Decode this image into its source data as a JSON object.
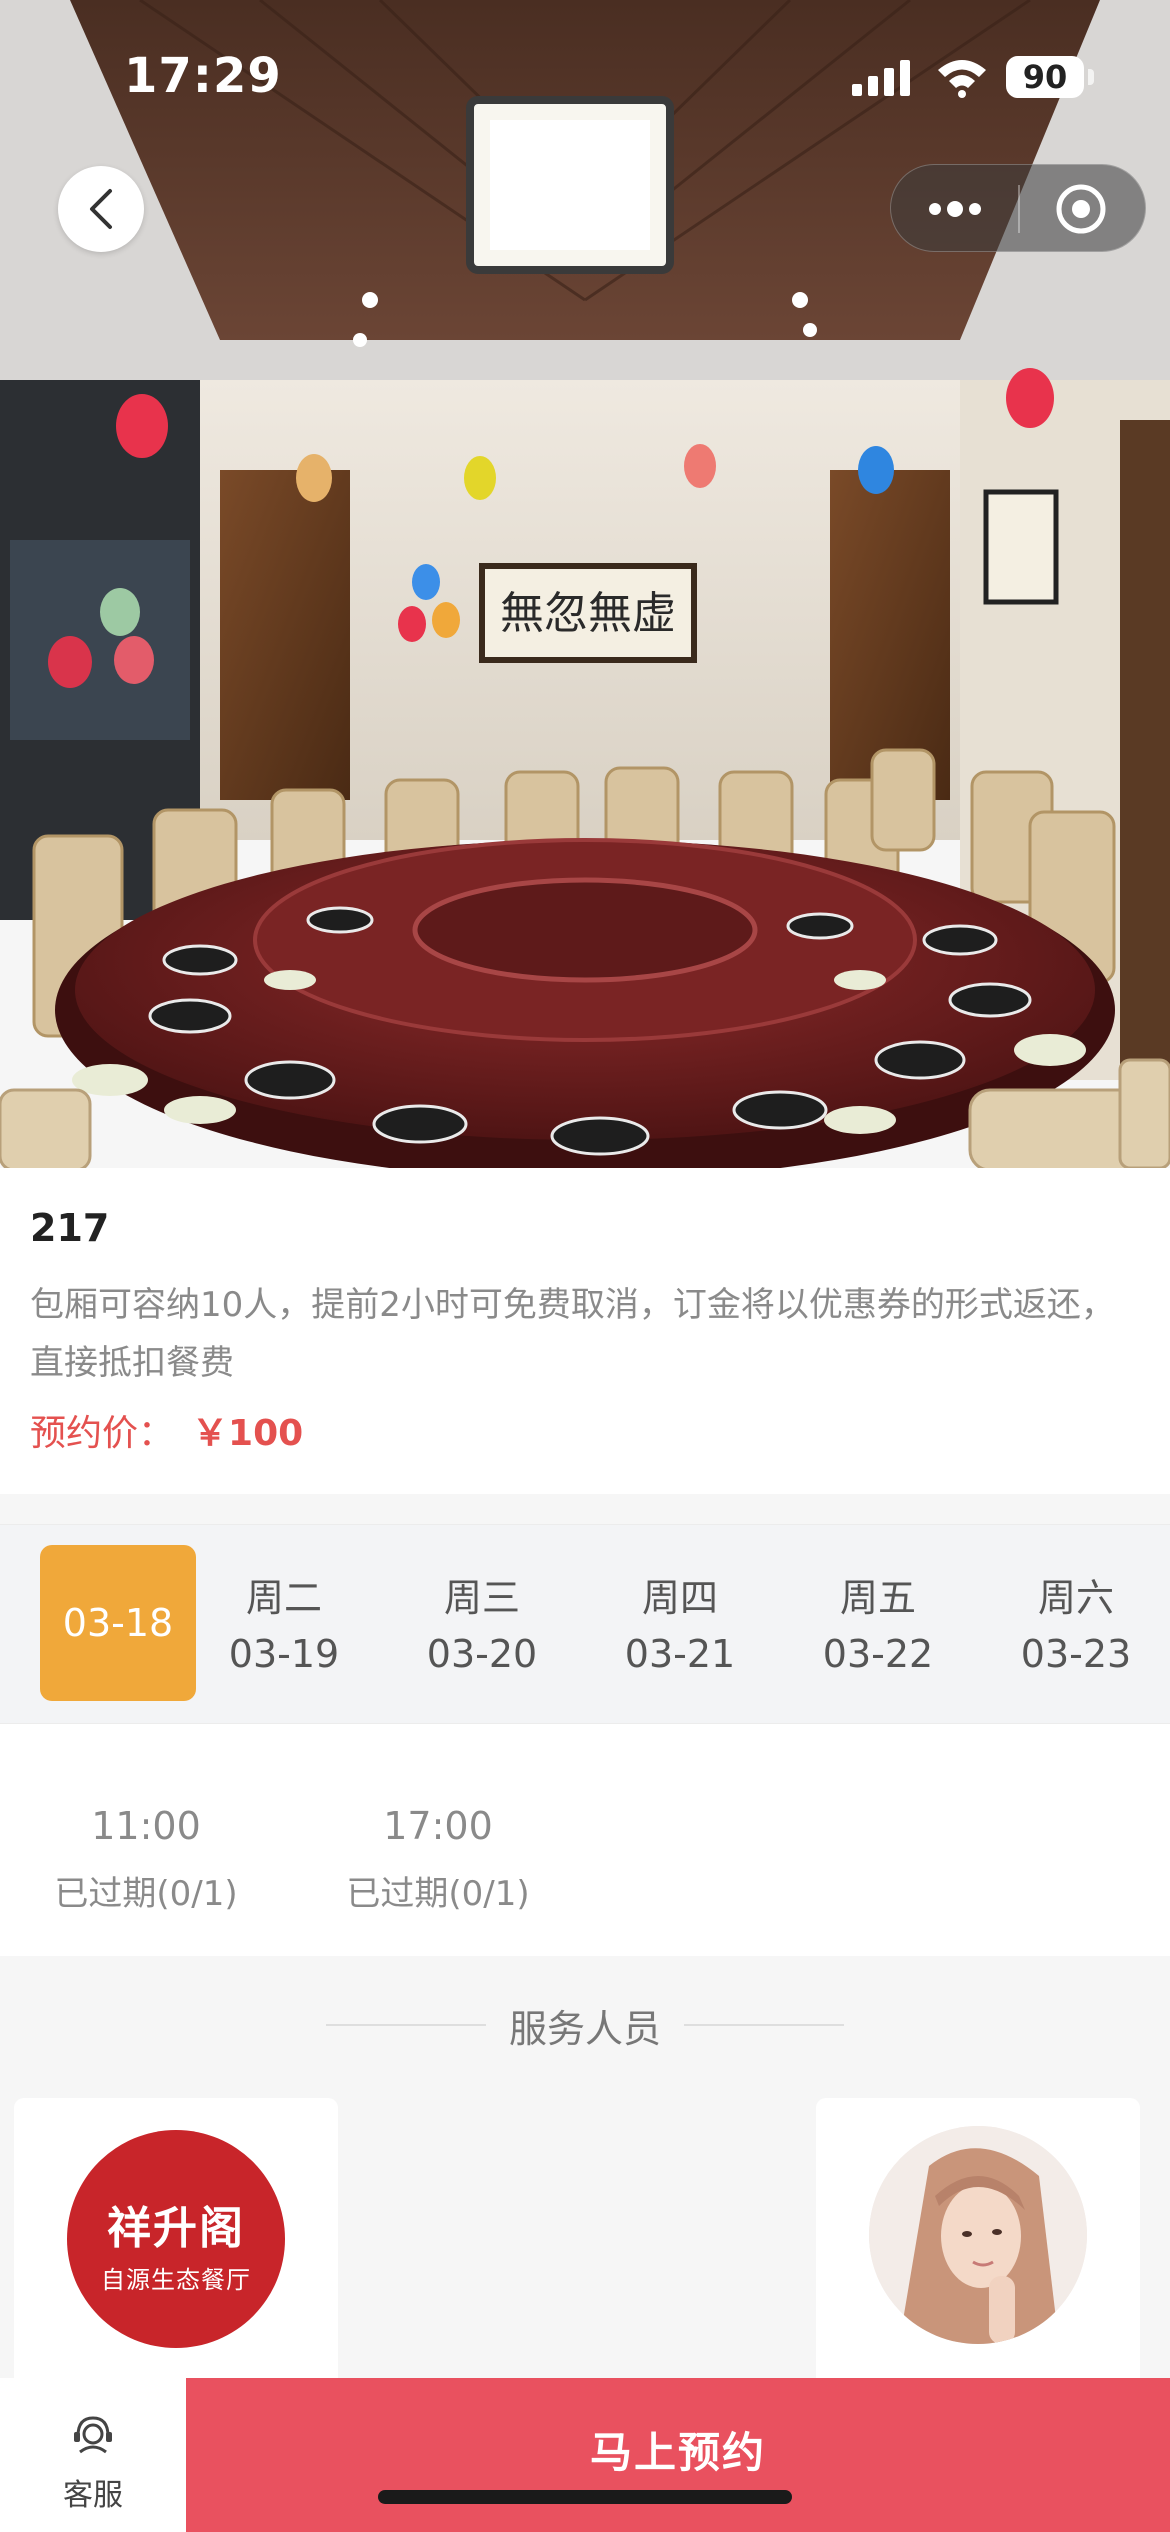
{
  "status_bar": {
    "time": "17:29",
    "battery": "90"
  },
  "hero": {
    "calligraphy": "無忽無虚"
  },
  "room": {
    "name": "217",
    "description": "包厢可容纳10人，提前2小时可免费取消，订金将以优惠券的形式返还，直接抵扣餐费",
    "price_label": "预约价：",
    "price_value": "￥100"
  },
  "dates": [
    {
      "weekday": "",
      "date": "03-18",
      "selected": true
    },
    {
      "weekday": "周二",
      "date": "03-19",
      "selected": false
    },
    {
      "weekday": "周三",
      "date": "03-20",
      "selected": false
    },
    {
      "weekday": "周四",
      "date": "03-21",
      "selected": false
    },
    {
      "weekday": "周五",
      "date": "03-22",
      "selected": false
    },
    {
      "weekday": "周六",
      "date": "03-23",
      "selected": false
    }
  ],
  "time_slots": [
    {
      "time": "11:00",
      "status": "已过期(0/1)"
    },
    {
      "time": "17:00",
      "status": "已过期(0/1)"
    }
  ],
  "staff": {
    "title": "服务人员",
    "logo_main": "祥升阁",
    "logo_sub": "自源生态餐厅"
  },
  "bottom_bar": {
    "service_label": "客服",
    "book_label": "马上预约"
  },
  "colors": {
    "accent": "#f0a83a",
    "price": "#e4514f",
    "book_button": "#e9515f",
    "logo_red": "#c8252a"
  }
}
